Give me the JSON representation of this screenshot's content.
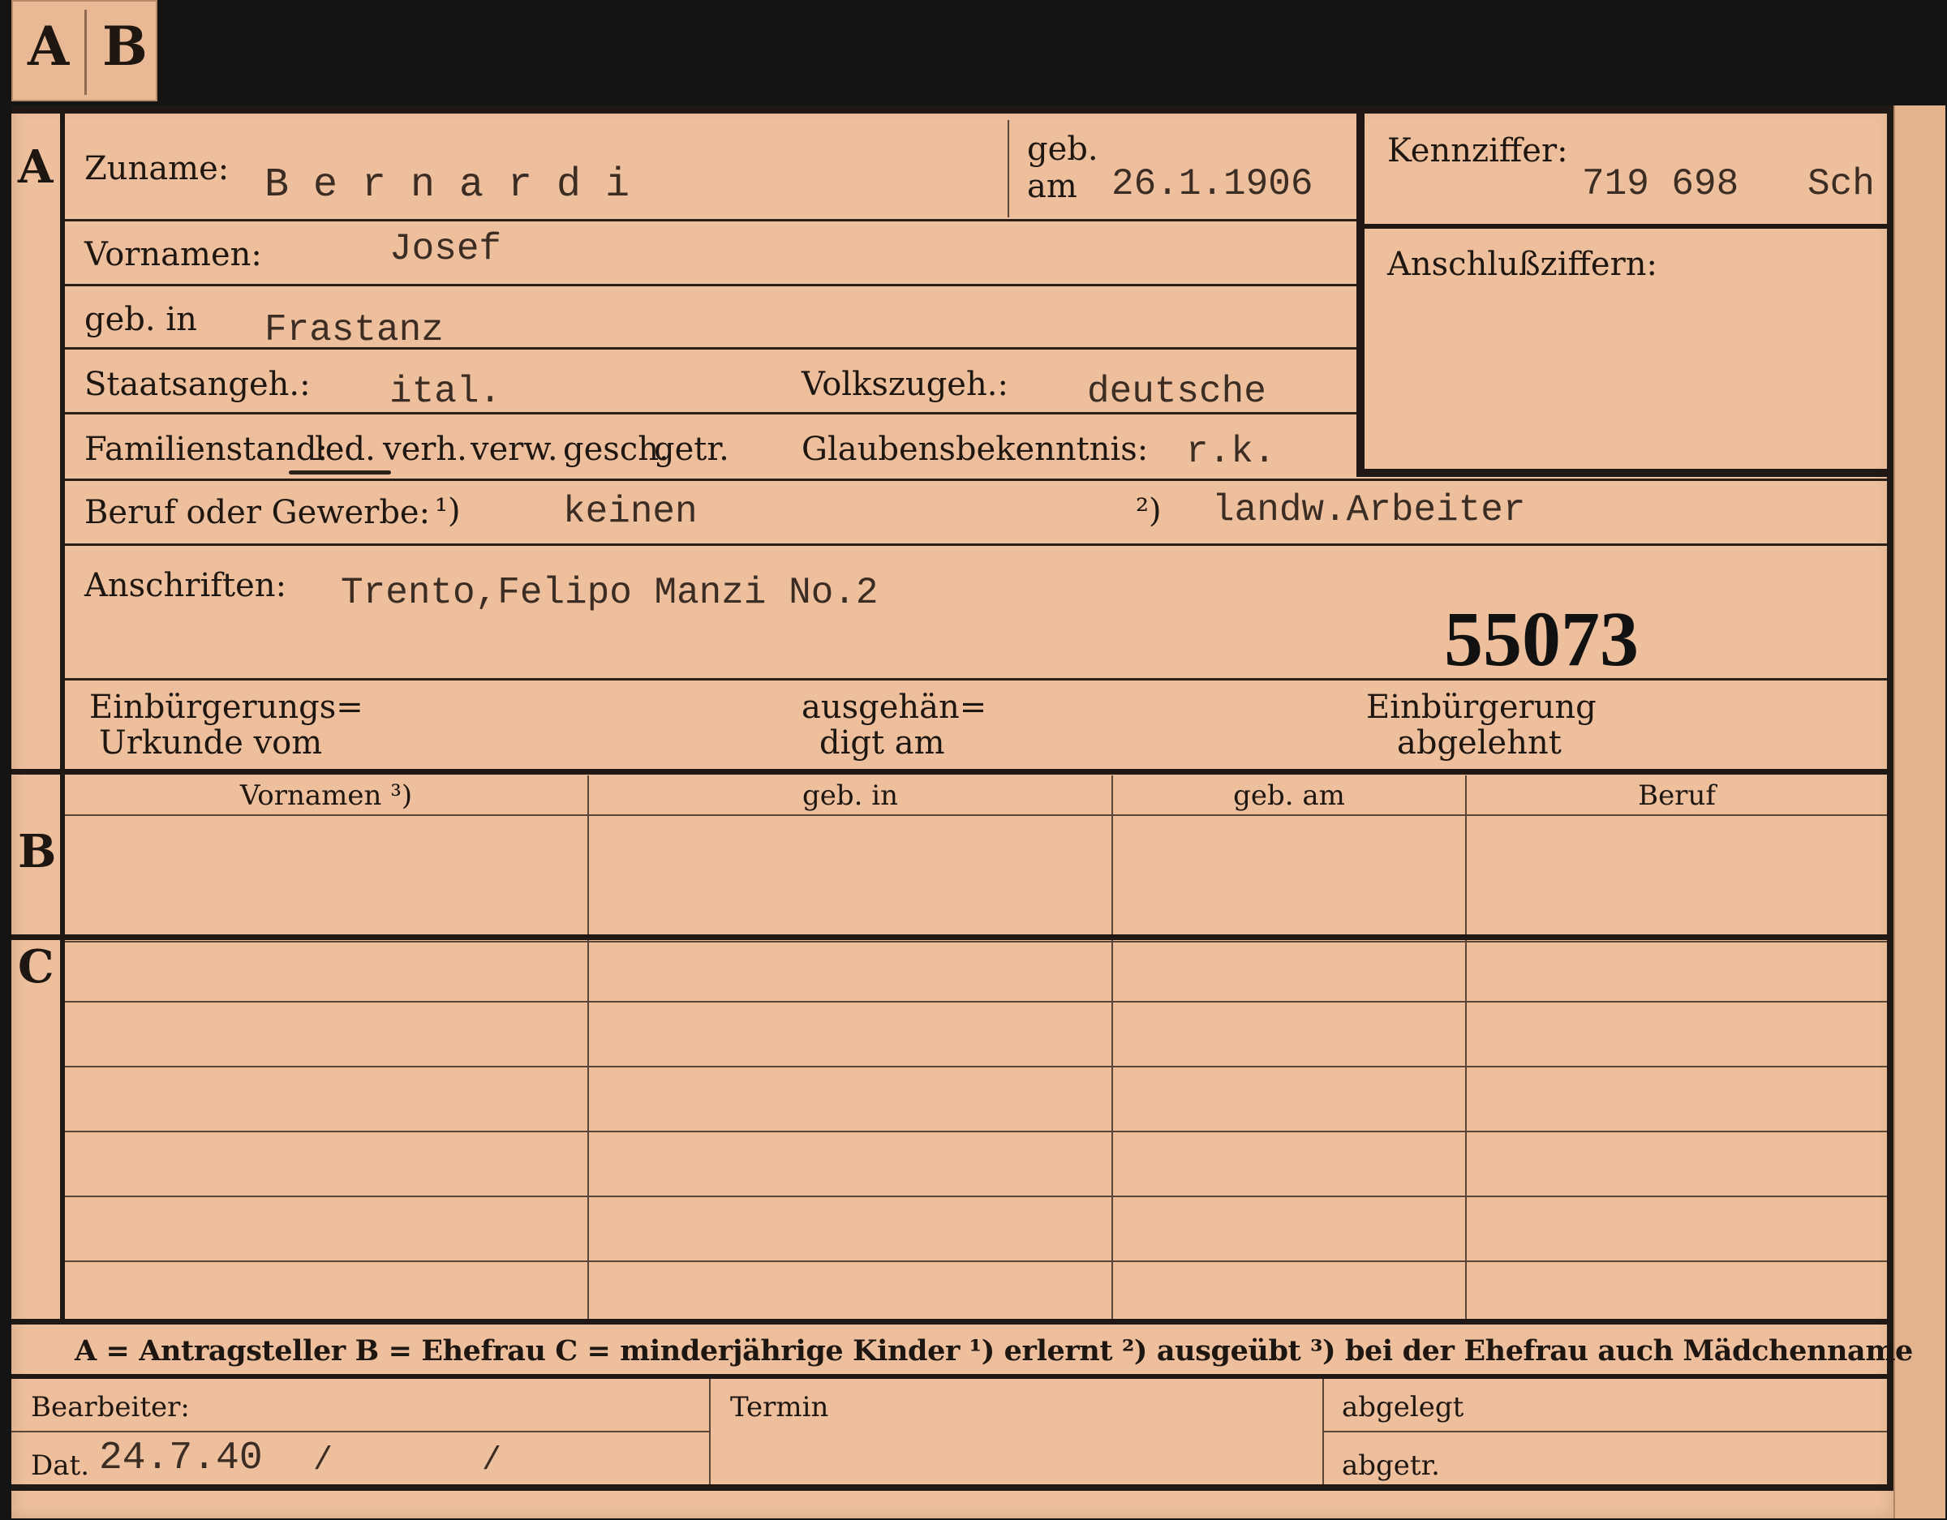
{
  "tab": {
    "letter_a": "A",
    "letter_b": "B"
  },
  "section_labels": {
    "a": "A",
    "b": "B",
    "c": "C"
  },
  "person": {
    "zuname_label": "Zuname:",
    "zuname": "B e r n a r d i",
    "geb_label": "geb.",
    "am_label": "am",
    "geb_am": "26.1.1906",
    "kennziffer_label": "Kennziffer:",
    "kennziffer": "719 698",
    "kennziffer_suffix": "Sch",
    "anschlussziffern_label": "Anschlußziffern:",
    "vornamen_label": "Vornamen:",
    "vornamen": "Josef",
    "geb_in_label": "geb. in",
    "geb_in": "Frastanz",
    "staatsangeh_label": "Staatsangeh.:",
    "staatsangeh": "ital.",
    "volkszugeh_label": "Volkszugeh.:",
    "volkszugeh": "deutsche",
    "familienstand_label": "Familienstand:",
    "familienstand_options": [
      "led.",
      "verh.",
      "verw.",
      "gesch.",
      "getr."
    ],
    "familienstand_selected": "led.",
    "glaubensbekenntnis_label": "Glaubensbekenntnis:",
    "glaubensbekenntnis": "r.k.",
    "beruf_label": "Beruf oder Gewerbe:",
    "beruf_note1": "¹)",
    "beruf_erlernt": "keinen",
    "beruf_note2": "²)",
    "beruf_ausgeuebt": "landw.Arbeiter",
    "anschriften_label": "Anschriften:",
    "anschriften": "Trento,Felipo Manzi No.2",
    "file_number": "55073",
    "einbuergerungs_label_1": "Einbürgerungs=",
    "einbuergerungs_label_2": "Urkunde vom",
    "ausgehaen_label_1": "ausgehän=",
    "ausgehaen_label_2": "digt am",
    "einbuergerung_label_1": "Einbürgerung",
    "einbuergerung_label_2": "abgelehnt"
  },
  "table_headers": [
    "Vornamen ³)",
    "geb. in",
    "geb. am",
    "Beruf"
  ],
  "legend": "A = Antragsteller   B = Ehefrau   C = minderjährige Kinder   ¹) erlernt   ²) ausgeübt   ³) bei der Ehefrau auch Mädchenname",
  "footer": {
    "bearbeiter_label": "Bearbeiter:",
    "termin_label": "Termin",
    "abgelegt_label": "abgelegt",
    "dat_label": "Dat.",
    "dat_value": "24.7.40",
    "slash_1": "/",
    "slash_2": "/",
    "abgetr_label": "abgetr."
  },
  "colors": {
    "card": "#edbf9c",
    "ink": "#1e1610",
    "typed": "#3b2d24",
    "background": "#141414"
  }
}
